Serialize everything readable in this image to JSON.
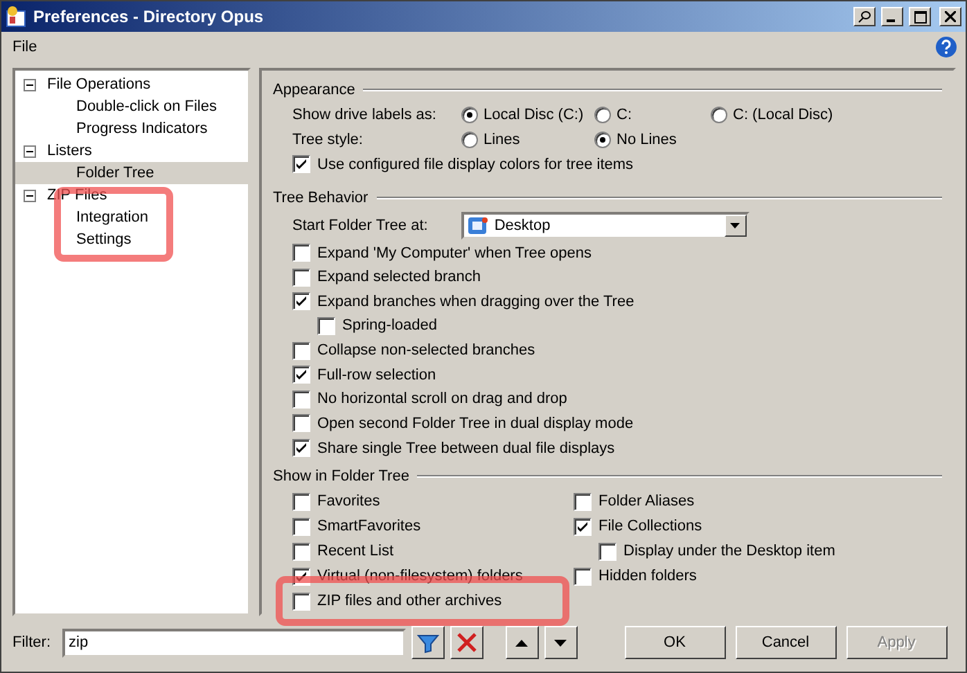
{
  "window": {
    "title": "Preferences - Directory Opus"
  },
  "menu": [
    {
      "label": "File"
    }
  ],
  "tree": [
    {
      "label": "File Operations",
      "expanded": true,
      "selected": false,
      "children": [
        {
          "label": "Double-click on Files",
          "selected": false
        },
        {
          "label": "Progress Indicators",
          "selected": false
        }
      ]
    },
    {
      "label": "Listers",
      "expanded": true,
      "selected": false,
      "children": [
        {
          "label": "Folder Tree",
          "selected": true
        }
      ]
    },
    {
      "label": "ZIP Files",
      "expanded": true,
      "selected": false,
      "children": [
        {
          "label": "Integration",
          "selected": false
        },
        {
          "label": "Settings",
          "selected": false
        }
      ]
    }
  ],
  "appearance": {
    "title": "Appearance",
    "drive_labels": {
      "label": "Show drive labels as:",
      "options": [
        {
          "label": "Local Disc (C:)",
          "selected": true
        },
        {
          "label": "C:",
          "selected": false
        },
        {
          "label": "C: (Local Disc)",
          "selected": false
        }
      ]
    },
    "tree_style": {
      "label": "Tree style:",
      "options": [
        {
          "label": "Lines",
          "selected": false
        },
        {
          "label": "No Lines",
          "selected": true
        }
      ]
    },
    "use_colors": {
      "label": "Use configured file display colors for tree items",
      "checked": true
    }
  },
  "tree_behavior": {
    "title": "Tree Behavior",
    "start_label": "Start Folder Tree at:",
    "start_value": "Desktop",
    "options": [
      {
        "label": "Expand 'My Computer' when Tree opens",
        "checked": false
      },
      {
        "label": "Expand selected branch",
        "checked": false
      },
      {
        "label": "Expand branches when dragging over the Tree",
        "checked": true,
        "children": [
          {
            "label": "Spring-loaded",
            "checked": false
          }
        ]
      },
      {
        "label": "Collapse non-selected branches",
        "checked": false
      },
      {
        "label": "Full-row selection",
        "checked": true
      },
      {
        "label": "No horizontal scroll on drag and drop",
        "checked": false
      },
      {
        "label": "Open second Folder Tree in dual display mode",
        "checked": false
      },
      {
        "label": "Share single Tree between dual file displays",
        "checked": true
      }
    ]
  },
  "show_in_tree": {
    "title": "Show in Folder Tree",
    "column_1": [
      {
        "label": "Favorites",
        "checked": false
      },
      {
        "label": "SmartFavorites",
        "checked": false
      },
      {
        "label": "Recent List",
        "checked": false
      },
      {
        "label": "Virtual (non-filesystem) folders",
        "checked": true
      },
      {
        "label": "ZIP files and other archives",
        "checked": false
      }
    ],
    "column_2": [
      {
        "label": "Folder Aliases",
        "checked": false
      },
      {
        "label": "File Collections",
        "checked": true,
        "children": [
          {
            "label": "Display under the Desktop item",
            "checked": false
          }
        ]
      },
      {
        "label": "Hidden folders",
        "checked": false
      }
    ]
  },
  "filter": {
    "label": "Filter:",
    "value": "zip"
  },
  "buttons": [
    {
      "label": "OK",
      "disabled": false
    },
    {
      "label": "Cancel",
      "disabled": false
    },
    {
      "label": "Apply",
      "disabled": true
    }
  ]
}
